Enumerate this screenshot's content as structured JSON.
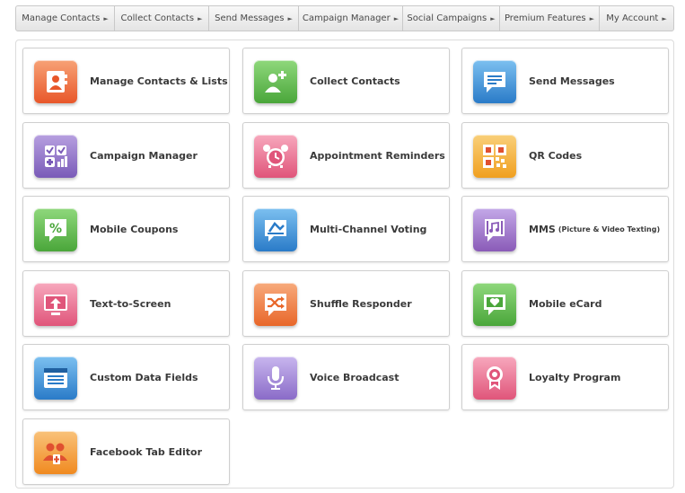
{
  "nav": [
    {
      "label": "Manage Contacts"
    },
    {
      "label": "Collect Contacts"
    },
    {
      "label": "Send Messages"
    },
    {
      "label": "Campaign Manager"
    },
    {
      "label": "Social Campaigns"
    },
    {
      "label": "Premium Features"
    },
    {
      "label": "My Account"
    }
  ],
  "nav_arrow": "►",
  "tiles": [
    {
      "label": "Manage Contacts & Lists",
      "icon": "contact-book-icon",
      "color": "#e8572a"
    },
    {
      "label": "Collect Contacts",
      "icon": "add-person-icon",
      "color": "#4aa63a"
    },
    {
      "label": "Send Messages",
      "icon": "message-bubble-icon",
      "color": "#2a7bc8"
    },
    {
      "label": "Campaign Manager",
      "icon": "dashboard-checklist-icon",
      "color": "#7a5bb8"
    },
    {
      "label": "Appointment Reminders",
      "icon": "alarm-clock-icon",
      "color": "#e0557a"
    },
    {
      "label": "QR Codes",
      "icon": "qr-code-icon",
      "color": "#f0a020"
    },
    {
      "label": "Mobile Coupons",
      "icon": "percent-coupon-icon",
      "color": "#4aa63a"
    },
    {
      "label": "Multi-Channel Voting",
      "icon": "ballot-icon",
      "color": "#2a7bc8"
    },
    {
      "label": "MMS",
      "note": "(Picture & Video Texting)",
      "icon": "music-media-icon",
      "color": "#8a5bb8"
    },
    {
      "label": "Text-to-Screen",
      "icon": "screen-upload-icon",
      "color": "#e0557a"
    },
    {
      "label": "Shuffle Responder",
      "icon": "shuffle-icon",
      "color": "#e8672a"
    },
    {
      "label": "Mobile eCard",
      "icon": "heart-card-icon",
      "color": "#4aa63a"
    },
    {
      "label": "Custom Data Fields",
      "icon": "form-fields-icon",
      "color": "#2a7bc8"
    },
    {
      "label": "Voice Broadcast",
      "icon": "microphone-icon",
      "color": "#8a6bc8"
    },
    {
      "label": "Loyalty Program",
      "icon": "award-ribbon-icon",
      "color": "#e0557a"
    },
    {
      "label": "Facebook Tab Editor",
      "icon": "add-group-icon",
      "color": "#f08a20"
    }
  ]
}
